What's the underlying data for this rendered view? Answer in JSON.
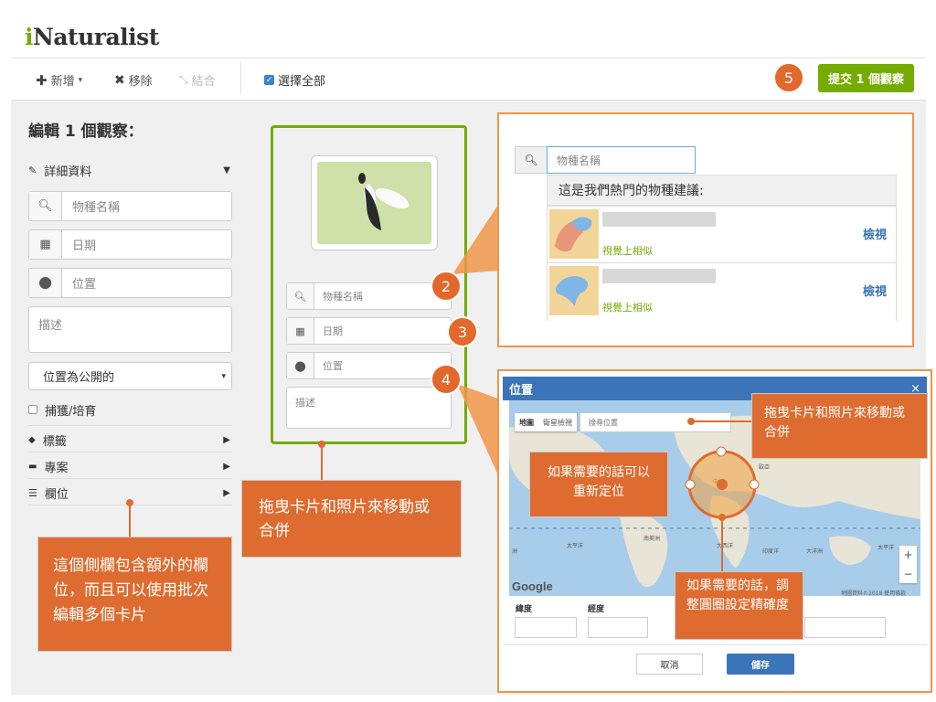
{
  "app": {
    "logo_i": "i",
    "logo_rest": "Naturalist"
  },
  "toolbar": {
    "add_label": "新增",
    "remove_label": "移除",
    "combine_label": "結合",
    "select_all_label": "選擇全部",
    "submit_label": "提交 1 個觀察",
    "step_badge": "5"
  },
  "sidebar": {
    "title": "編輯 1 個觀察：",
    "details_label": "詳細資料",
    "species_placeholder": "物種名稱",
    "date_placeholder": "日期",
    "location_placeholder": "位置",
    "description_placeholder": "描述",
    "geoprivacy_value": "位置為公開的",
    "captive_label": "捕獲/培育",
    "tags_label": "標籤",
    "projects_label": "專案",
    "fields_label": "欄位"
  },
  "card": {
    "species_placeholder": "物種名稱",
    "date_placeholder": "日期",
    "location_placeholder": "位置",
    "description_placeholder": "描述"
  },
  "badges": {
    "b2": "2",
    "b3": "3",
    "b4": "4"
  },
  "suggestions": {
    "input_placeholder": "物種名稱",
    "header": "這是我們熱門的物種建議:",
    "items": [
      {
        "tag": "視覺上相似",
        "view": "檢視"
      },
      {
        "tag": "視覺上相似",
        "view": "檢視"
      }
    ]
  },
  "location_modal": {
    "title": "位置",
    "close": "×",
    "map_tab": "地圖",
    "satellite_tab": "衛星檢視",
    "search_placeholder": "搜尋位置",
    "lat_label": "緯度",
    "lng_label": "經度",
    "cancel_label": "取消",
    "save_label": "儲存",
    "zoom_in": "+",
    "zoom_out": "−",
    "google": "Google",
    "map_credit": "地圖資料©2018  使用條款",
    "map_labels": [
      "歐亞",
      "北美洲",
      "太平洋",
      "南美洲",
      "大西洋",
      "印度洋",
      "大洋洲",
      "太平洋",
      "洲",
      "中"
    ]
  },
  "callouts": {
    "sidebar_note": "這個側欄包含額外的欄位，而且可以使用批次編輯多個卡片",
    "card_note": "拖曳卡片和照片來移動或合併",
    "map_drag_note": "拖曳卡片和照片來移動或合併",
    "reposition_note": "如果需要的話可以重新定位",
    "accuracy_note": "如果需要的話，調整圓圈設定精確度"
  }
}
